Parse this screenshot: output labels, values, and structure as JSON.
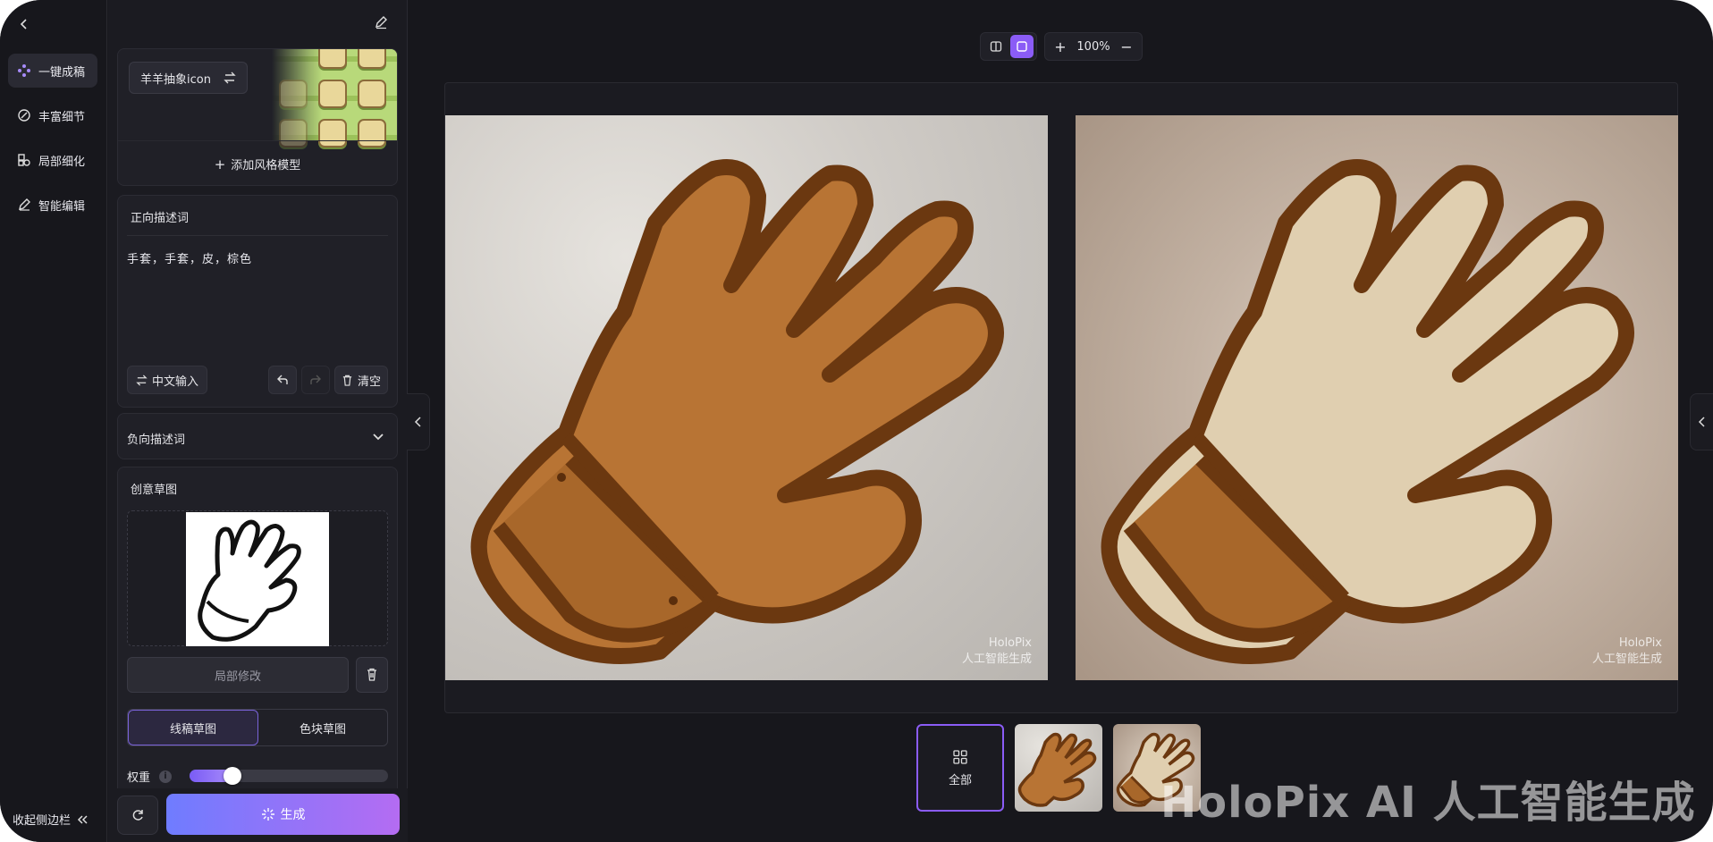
{
  "rail": {
    "items": [
      {
        "label": "一键成稿",
        "icon": "sparkle-dots-icon",
        "active": true
      },
      {
        "label": "丰富细节",
        "icon": "magic-wand-icon",
        "active": false
      },
      {
        "label": "局部细化",
        "icon": "shapes-icon",
        "active": false
      },
      {
        "label": "智能编辑",
        "icon": "pencil-icon",
        "active": false
      }
    ],
    "collapse_label": "收起侧边栏"
  },
  "style_model": {
    "tag_label": "羊羊抽象icon",
    "add_label": "添加风格模型"
  },
  "positive_prompt": {
    "title": "正向描述词",
    "text": "手套，手套，皮，棕色",
    "translate_label": "中文输入",
    "clear_label": "清空"
  },
  "negative_prompt": {
    "title": "负向描述词"
  },
  "sketch": {
    "title": "创意草图",
    "local_edit_label": "局部修改",
    "modes": [
      "线稿草图",
      "色块草图"
    ],
    "selected_mode": "线稿草图",
    "weight_label": "权重",
    "weight_value": 0.19
  },
  "actions": {
    "generate_label": "生成"
  },
  "toolbar": {
    "zoom": "100%"
  },
  "images": {
    "watermark_line1": "HoloPix",
    "watermark_line2": "人工智能生成"
  },
  "thumbs": {
    "all_label": "全部"
  },
  "big_watermark": "HoloPix AI 人工智能生成",
  "colors": {
    "accent": "#8b5cf6",
    "glove_brown": "#b87434",
    "glove_outline": "#6b3810",
    "glove_cream": "#e0cfb0"
  }
}
